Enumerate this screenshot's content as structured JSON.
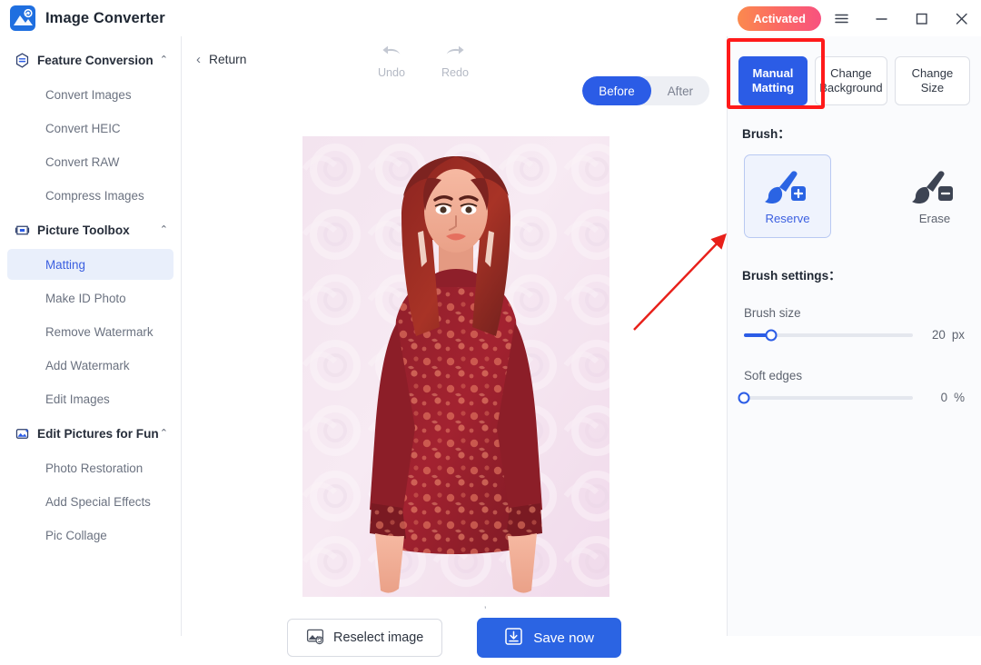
{
  "titlebar": {
    "app_title": "Image Converter",
    "logo_icon": "image-converter-logo",
    "activated_label": "Activated",
    "menu_icon": "hamburger-menu-icon",
    "minimize_icon": "minimize-icon",
    "maximize_icon": "maximize-icon",
    "close_icon": "close-icon"
  },
  "sidebar": {
    "groups": [
      {
        "label": "Feature Conversion",
        "icon": "feature-conversion-icon",
        "chevron": "⌃",
        "items": [
          {
            "label": "Convert Images",
            "active": false
          },
          {
            "label": "Convert HEIC",
            "active": false
          },
          {
            "label": "Convert RAW",
            "active": false
          },
          {
            "label": "Compress Images",
            "active": false
          }
        ]
      },
      {
        "label": "Picture Toolbox",
        "icon": "picture-toolbox-icon",
        "chevron": "⌃",
        "items": [
          {
            "label": "Matting",
            "active": true
          },
          {
            "label": "Make ID Photo",
            "active": false
          },
          {
            "label": "Remove Watermark",
            "active": false
          },
          {
            "label": "Add Watermark",
            "active": false
          },
          {
            "label": "Edit Images",
            "active": false
          }
        ]
      },
      {
        "label": "Edit Pictures for Fun",
        "icon": "edit-pictures-for-fun-icon",
        "chevron": "⌃",
        "items": [
          {
            "label": "Photo Restoration",
            "active": false
          },
          {
            "label": "Add Special Effects",
            "active": false
          },
          {
            "label": "Pic Collage",
            "active": false
          }
        ]
      }
    ]
  },
  "editor": {
    "return_label": "Return",
    "return_icon": "chevron-left-icon",
    "undo_label": "Undo",
    "undo_icon": "undo-arrow-icon",
    "redo_label": "Redo",
    "redo_icon": "redo-arrow-icon",
    "toggle": {
      "before_label": "Before",
      "after_label": "After",
      "selected": "Before"
    },
    "image_alt": "portrait-photo-woman-red-floral-dress",
    "reselect_label": "Reselect image",
    "reselect_icon": "reselect-image-icon",
    "save_label": "Save now",
    "save_icon": "download-save-icon"
  },
  "panel": {
    "tabs": [
      {
        "label": "Manual Matting",
        "selected": true
      },
      {
        "label": "Change Background",
        "selected": false
      },
      {
        "label": "Change Size",
        "selected": false
      }
    ],
    "brush_section_label": "Brush：",
    "brush_options": [
      {
        "label": "Reserve",
        "icon": "brush-plus-icon",
        "selected": true
      },
      {
        "label": "Erase",
        "icon": "brush-minus-icon",
        "selected": false
      }
    ],
    "brush_settings_label": "Brush settings：",
    "sliders": [
      {
        "name": "Brush size",
        "value": "20",
        "unit": "px",
        "percent": 16
      },
      {
        "name": "Soft edges",
        "value": "0",
        "unit": "%",
        "percent": 0
      }
    ]
  },
  "annotations": {
    "highlight_box": "manual-matting-highlight-box",
    "arrow": "red-arrow-pointing-to-reserve-brush",
    "color": "#ff1a1a"
  },
  "colors": {
    "accent_blue": "#2b5ce6",
    "save_blue": "#2b64e3",
    "active_item_bg": "#e9effb",
    "panel_bg": "#fafbfd",
    "annotation_red": "#ff1a1a"
  }
}
